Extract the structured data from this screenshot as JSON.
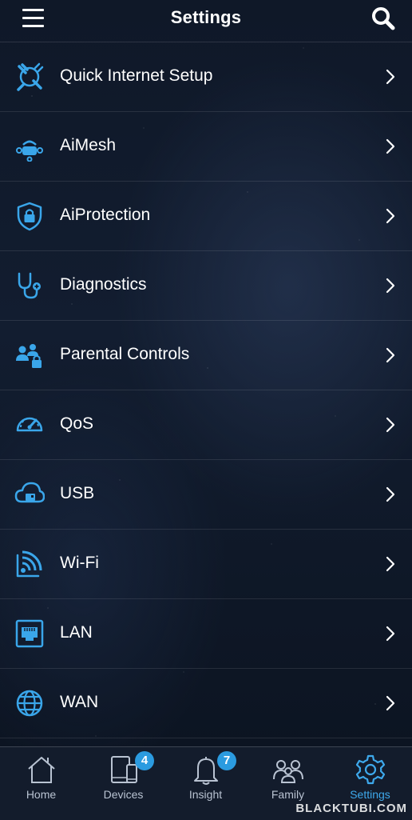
{
  "header": {
    "title": "Settings",
    "menu_icon": "hamburger-menu-icon",
    "search_icon": "search-icon"
  },
  "settings": {
    "items": [
      {
        "label": "Quick Internet Setup",
        "icon": "tools-globe-icon"
      },
      {
        "label": "AiMesh",
        "icon": "mesh-router-icon"
      },
      {
        "label": "AiProtection",
        "icon": "shield-lock-icon"
      },
      {
        "label": "Diagnostics",
        "icon": "stethoscope-icon"
      },
      {
        "label": "Parental Controls",
        "icon": "family-lock-icon"
      },
      {
        "label": "QoS",
        "icon": "speedometer-icon"
      },
      {
        "label": "USB",
        "icon": "cloud-usb-icon"
      },
      {
        "label": "Wi-Fi",
        "icon": "wifi-signal-icon"
      },
      {
        "label": "LAN",
        "icon": "ethernet-port-icon"
      },
      {
        "label": "WAN",
        "icon": "globe-icon"
      }
    ]
  },
  "tabbar": {
    "tabs": [
      {
        "label": "Home",
        "icon": "house-icon"
      },
      {
        "label": "Devices",
        "icon": "devices-icon",
        "badge": "4"
      },
      {
        "label": "Insight",
        "icon": "bell-icon",
        "badge": "7"
      },
      {
        "label": "Family",
        "icon": "family-icon"
      },
      {
        "label": "Settings",
        "icon": "gear-icon",
        "active": true
      }
    ]
  },
  "watermark": "BLACKTUBI.COM",
  "colors": {
    "accent": "#3ea9ec",
    "badge": "#2b9be0",
    "icon_blue": "#3aa6ea",
    "tab_inactive": "#b9c3d2"
  }
}
